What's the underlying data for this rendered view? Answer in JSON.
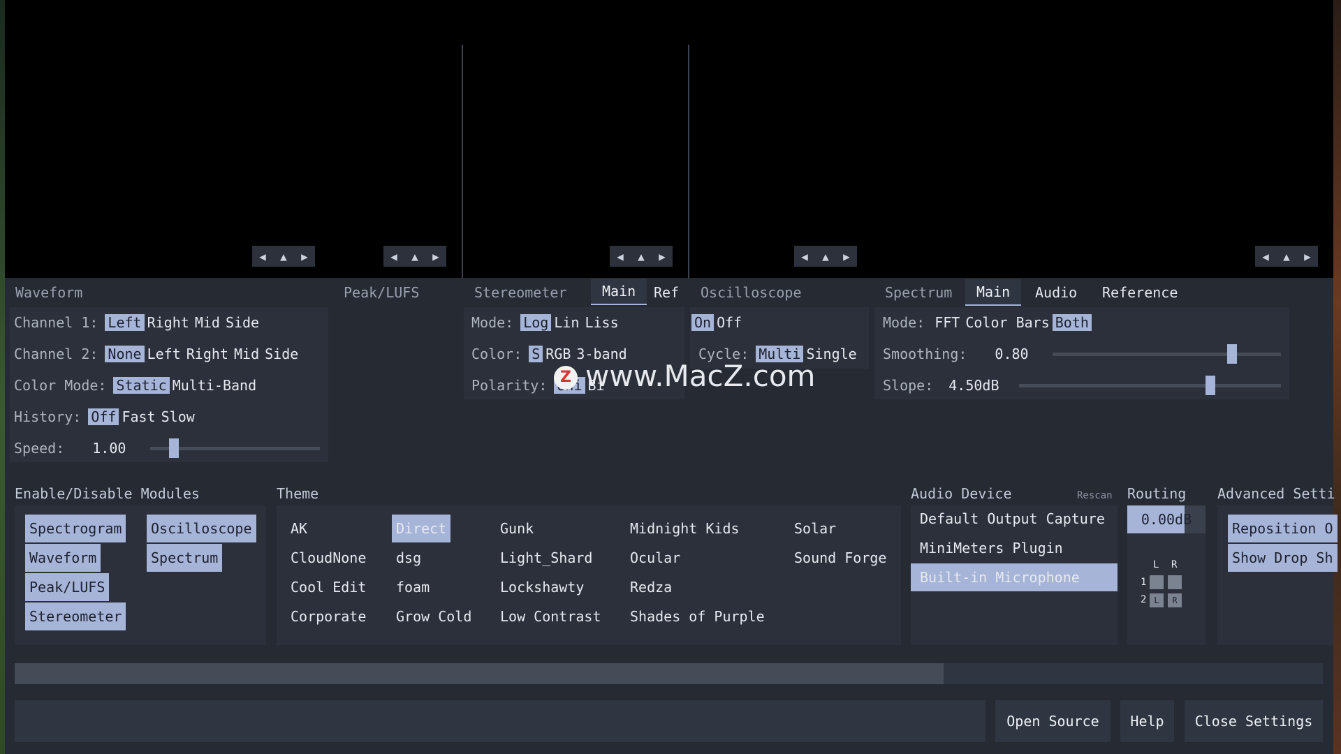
{
  "arrows": [
    "◀",
    "▲",
    "▶"
  ],
  "waveform": {
    "title": "Waveform",
    "channel1_label": "Channel 1:",
    "channel1_opts": [
      "Left",
      "Right",
      "Mid",
      "Side"
    ],
    "channel2_label": "Channel 2:",
    "channel2_opts": [
      "None",
      "Left",
      "Right",
      "Mid",
      "Side"
    ],
    "color_mode_label": "Color Mode:",
    "color_mode_opts": [
      "Static",
      "Multi-Band"
    ],
    "history_label": "History:",
    "history_opts": [
      "Off",
      "Fast",
      "Slow"
    ],
    "speed_label": "Speed:",
    "speed_value": "1.00"
  },
  "peak": {
    "title": "Peak/LUFS"
  },
  "stereometer": {
    "title": "Stereometer",
    "tabs": [
      "Main",
      "Ref"
    ],
    "mode_label": "Mode:",
    "mode_opts": [
      "Log",
      "Lin",
      "Liss"
    ],
    "color_label": "Color:",
    "color_opts": [
      "S",
      "RGB",
      "3-band"
    ],
    "polarity_label": "Polarity:",
    "polarity_opts": [
      "Uni",
      "Bi"
    ]
  },
  "oscilloscope": {
    "title": "Oscilloscope",
    "onoff_opts": [
      "On",
      "Off"
    ],
    "cycle_label": "Cycle:",
    "cycle_opts": [
      "Multi",
      "Single"
    ]
  },
  "spectrum": {
    "title": "Spectrum",
    "tabs": [
      "Main",
      "Audio",
      "Reference"
    ],
    "mode_label": "Mode:",
    "mode_opts": [
      "FFT",
      "Color Bars",
      "Both"
    ],
    "smoothing_label": "Smoothing:",
    "smoothing_value": "0.80",
    "slope_label": "Slope:",
    "slope_value": "4.50dB"
  },
  "modules": {
    "title": "Enable/Disable Modules",
    "items": [
      "Spectrogram",
      "Oscilloscope",
      "Waveform",
      "Spectrum",
      "Peak/LUFS",
      "Stereometer"
    ]
  },
  "theme": {
    "title": "Theme",
    "items": [
      "AK",
      "Direct",
      "Gunk",
      "Midnight Kids",
      "Solar",
      "CloudNone",
      "dsg",
      "Light_Shard",
      "Ocular",
      "Sound Forge",
      "Cool Edit",
      "foam",
      "Lockshawty",
      "Redza",
      "Corporate",
      "Grow Cold",
      "Low Contrast",
      "Shades of Purple"
    ]
  },
  "audio_device": {
    "title": "Audio Device",
    "rescan": "Rescan",
    "items": [
      "Default Output Capture",
      "MiniMeters Plugin",
      "Built-in Microphone"
    ]
  },
  "routing": {
    "title": "Routing",
    "gain": "0.00dB",
    "col_labels": [
      "L",
      "R"
    ],
    "row_labels": [
      "1",
      "2"
    ],
    "cell_labels": [
      "L",
      "R"
    ]
  },
  "advanced": {
    "title": "Advanced Setti",
    "items": [
      "Reposition O",
      "Show Drop Sh"
    ]
  },
  "buttons": {
    "open_source": "Open Source",
    "help": "Help",
    "close": "Close Settings"
  },
  "watermark": "www.MacZ.com",
  "watermark_badge": "Z",
  "colors": {
    "accent": "#a6b4d8",
    "panel": "#252a33",
    "background": "#000000"
  },
  "values": {
    "speed_fraction": 0.12,
    "smoothing_fraction": 0.8,
    "slope_fraction": 0.74,
    "progress_fraction": 0.71
  }
}
